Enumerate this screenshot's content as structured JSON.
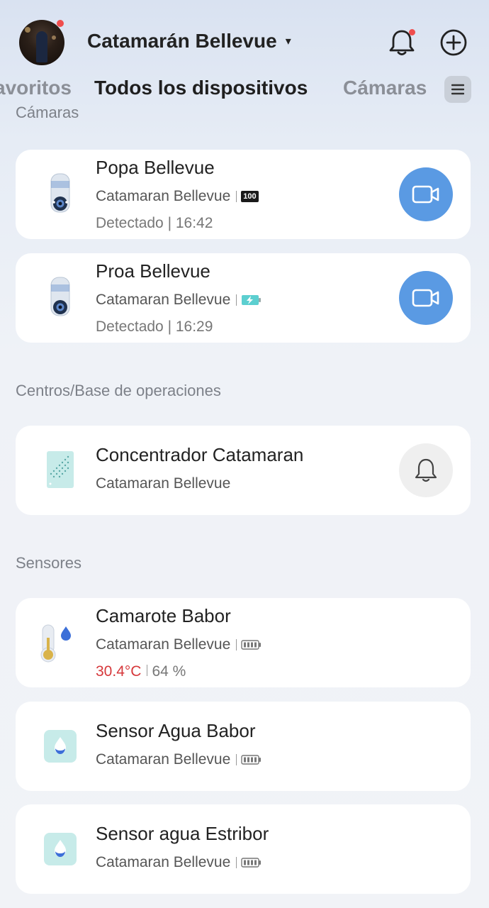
{
  "header": {
    "home_name": "Catamarán Bellevue",
    "caret": "▾",
    "avatar_icon": "avatar",
    "notifications_icon": "bell-icon",
    "add_icon": "plus-circle-icon",
    "badge_color": "#ef4d4d"
  },
  "tabs": [
    {
      "label": "Favoritos",
      "visible_text": "avoritos",
      "active": false
    },
    {
      "label": "Todos los dispositivos",
      "active": true
    },
    {
      "label": "Cámaras",
      "active": false
    }
  ],
  "tabs_menu_icon": "list-icon",
  "sections": {
    "cameras": {
      "label": "Cámaras",
      "devices": [
        {
          "name": "Popa Bellevue",
          "location": "Catamaran Bellevue",
          "battery": "100",
          "battery_icon": "battery-badge",
          "status": "Detectado | 16:42",
          "action_icon": "video-camera-icon"
        },
        {
          "name": "Proa Bellevue",
          "location": "Catamaran Bellevue",
          "battery_icon": "battery-charging-icon",
          "status": "Detectado | 16:29",
          "action_icon": "video-camera-icon"
        }
      ]
    },
    "hubs": {
      "label": "Centros/Base de operaciones",
      "devices": [
        {
          "name": "Concentrador Catamaran",
          "location": "Catamaran Bellevue",
          "action_icon": "bell-icon"
        }
      ]
    },
    "sensors": {
      "label": "Sensores",
      "devices": [
        {
          "name": "Camarote Babor",
          "location": "Catamaran Bellevue",
          "battery_icon": "battery-full-icon",
          "temperature": "30.4°C",
          "humidity": "64 %"
        },
        {
          "name": "Sensor Agua Babor",
          "location": "Catamaran Bellevue",
          "battery_icon": "battery-full-icon"
        },
        {
          "name": "Sensor agua Estribor",
          "location": "Catamaran Bellevue",
          "battery_icon": "battery-full-icon"
        }
      ]
    }
  },
  "colors": {
    "accent_blue": "#5a9ae3",
    "temperature_red": "#d6383b",
    "charging_teal": "#5ccfd0"
  }
}
